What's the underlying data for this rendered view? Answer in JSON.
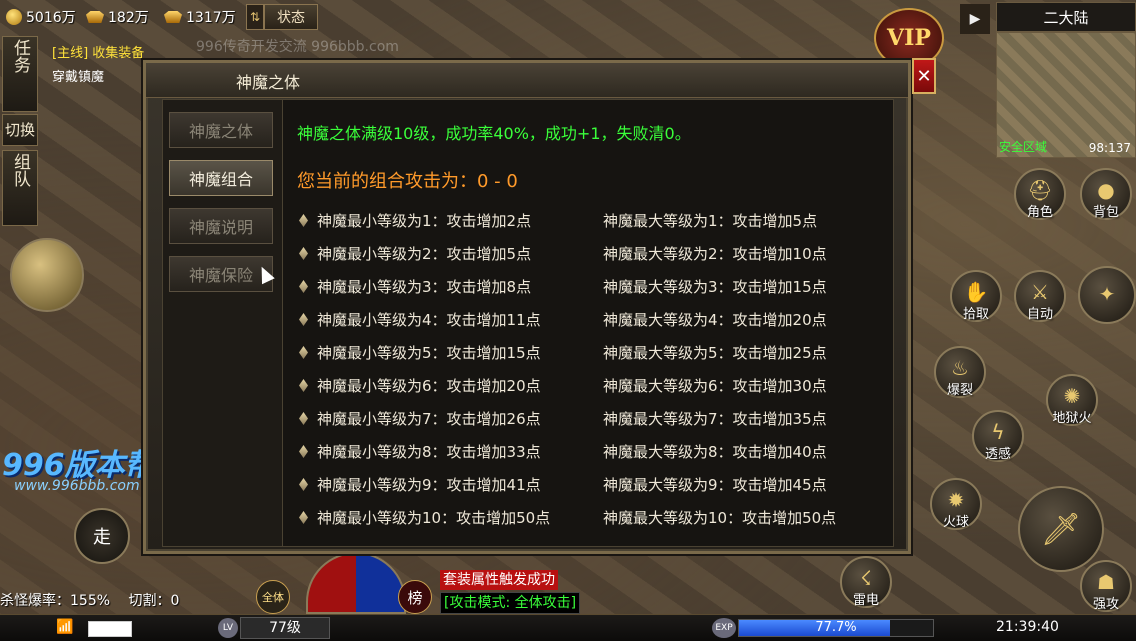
{
  "hud": {
    "gold": "5016万",
    "ingot": "182万",
    "bound_ingot": "1317万",
    "status_label": "状态",
    "swap_icon": "swap-icon",
    "side_tabs": [
      "任务",
      "切换",
      "组队"
    ],
    "quest_line1": "[主线] 收集装备",
    "quest_line2": "穿戴镇魔",
    "watermark": "996传奇开发交流 996bbb.com",
    "map_name": "二大陆",
    "safe_zone": "安全区域",
    "coords": "98:137",
    "vip": "VIP",
    "right_buttons": [
      "角色",
      "背包",
      "拾取",
      "自动",
      "爆裂",
      "透感",
      "火球",
      "地狱火",
      "强攻",
      "雷电"
    ],
    "kill_rate": "杀怪爆率：155%",
    "cut": "切割：0",
    "msg_set": "套装属性触发成功",
    "msg_mode": "[攻击模式: 全体攻击]",
    "walk": "走",
    "all_body": "全体",
    "rank": "榜",
    "level": "77级",
    "exp": "77.7%",
    "exp_fraction": 0.777,
    "time": "21:39:40",
    "logo": "996版本帮",
    "logo_url": "www.996bbb.com"
  },
  "dialog": {
    "title": "神魔之体",
    "close": "✕",
    "tabs": [
      {
        "label": "神魔之体",
        "active": false
      },
      {
        "label": "神魔组合",
        "active": true
      },
      {
        "label": "神魔说明",
        "active": false
      },
      {
        "label": "神魔保险",
        "active": false
      }
    ],
    "summary": "神魔之体满级10级，成功率40%，成功+1，失败清0。",
    "current": "您当前的组合攻击为：0 - 0",
    "min_rows": [
      "神魔最小等级为1：攻击增加2点",
      "神魔最小等级为2：攻击增加5点",
      "神魔最小等级为3：攻击增加8点",
      "神魔最小等级为4：攻击增加11点",
      "神魔最小等级为5：攻击增加15点",
      "神魔最小等级为6：攻击增加20点",
      "神魔最小等级为7：攻击增加26点",
      "神魔最小等级为8：攻击增加33点",
      "神魔最小等级为9：攻击增加41点",
      "神魔最小等级为10：攻击增加50点"
    ],
    "max_rows": [
      "神魔最大等级为1：攻击增加5点",
      "神魔最大等级为2：攻击增加10点",
      "神魔最大等级为3：攻击增加15点",
      "神魔最大等级为4：攻击增加20点",
      "神魔最大等级为5：攻击增加25点",
      "神魔最大等级为6：攻击增加30点",
      "神魔最大等级为7：攻击增加35点",
      "神魔最大等级为8：攻击增加40点",
      "神魔最大等级为9：攻击增加45点",
      "神魔最大等级为10：攻击增加50点"
    ]
  },
  "colors": {
    "summary": "#3aff3a",
    "current": "#ff9a2a",
    "close": "#c01818"
  }
}
